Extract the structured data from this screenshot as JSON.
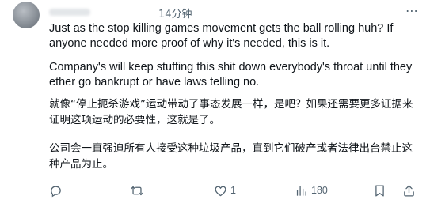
{
  "tweet": {
    "timestamp": "14分钟",
    "paragraphs_en": [
      "Just as the stop killing games movement gets the ball rolling huh? If anyone needed more proof of why it's needed, this is it.",
      "Company's will keep stuffing this shit down everybody's throat until they ether go bankrupt or have laws telling no."
    ],
    "paragraphs_zh": [
      "就像“停止扼杀游戏”运动带动了事态发展一样，是吧？如果还需要更多证据来证明这项运动的必要性，这就是了。",
      "公司会一直强迫所有人接受这种垃圾产品，直到它们破产或者法律出台禁止这种产品为止。"
    ]
  },
  "actions": {
    "reply_icon": "reply-icon",
    "retweet_icon": "retweet-icon",
    "like_icon": "heart-icon",
    "like_count": "1",
    "views_icon": "bar-chart-icon",
    "views_count": "180",
    "bookmark_icon": "bookmark-icon",
    "share_icon": "share-icon"
  },
  "colors": {
    "text": "#0f1419",
    "muted": "#536471"
  }
}
